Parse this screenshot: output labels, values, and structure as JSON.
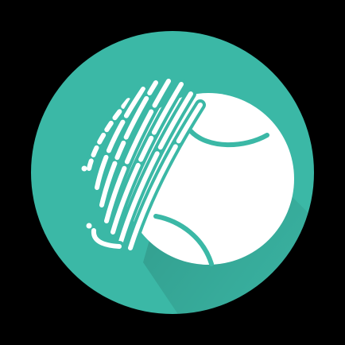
{
  "app_icon": {
    "icon": "fingerprint-ball-icon",
    "background": "#000000",
    "circle_color": "#3bb8a6",
    "shadow_color": "#2a8a7c",
    "mark_color": "#ffffff"
  }
}
